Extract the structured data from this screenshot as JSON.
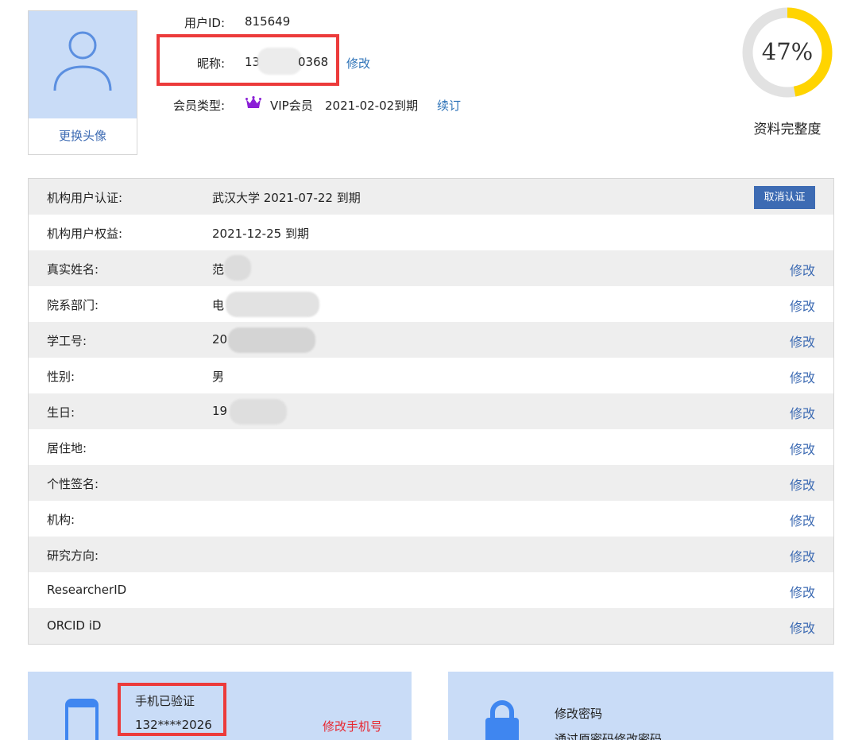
{
  "avatar": {
    "change_label": "更换头像"
  },
  "profile": {
    "user_id_label": "用户ID:",
    "user_id": "815649",
    "nickname_label": "昵称:",
    "nickname_prefix": "13",
    "nickname_suffix": "0368",
    "nickname_edit": "修改",
    "member_type_label": "会员类型:",
    "member_type": "VIP会员",
    "member_expiry": "2021-02-02到期",
    "renew": "续订"
  },
  "completeness": {
    "percent": 47,
    "percent_text": "47%",
    "label": "资料完整度",
    "color_fill": "#ffd400",
    "color_track": "#e2e2e2"
  },
  "table": {
    "edit_label": "修改",
    "cancel_auth": "取消认证",
    "rows": [
      {
        "key": "机构用户认证:",
        "value": "武汉大学 2021-07-22 到期"
      },
      {
        "key": "机构用户权益:",
        "value": "2021-12-25 到期"
      },
      {
        "key": "真实姓名:",
        "value": "范"
      },
      {
        "key": "院系部门:",
        "value": "电"
      },
      {
        "key": "学工号:",
        "value": "20"
      },
      {
        "key": "性别:",
        "value": "男"
      },
      {
        "key": "生日:",
        "value": "19"
      },
      {
        "key": "居住地:",
        "value": ""
      },
      {
        "key": "个性签名:",
        "value": ""
      },
      {
        "key": "机构:",
        "value": ""
      },
      {
        "key": "研究方向:",
        "value": ""
      },
      {
        "key": "ResearcherID",
        "value": ""
      },
      {
        "key": "ORCID iD",
        "value": ""
      }
    ]
  },
  "phone_card": {
    "status": "手机已验证",
    "number": "132****2026",
    "action": "修改手机号"
  },
  "password_card": {
    "title": "修改密码",
    "desc": "通过原密码修改密码"
  }
}
